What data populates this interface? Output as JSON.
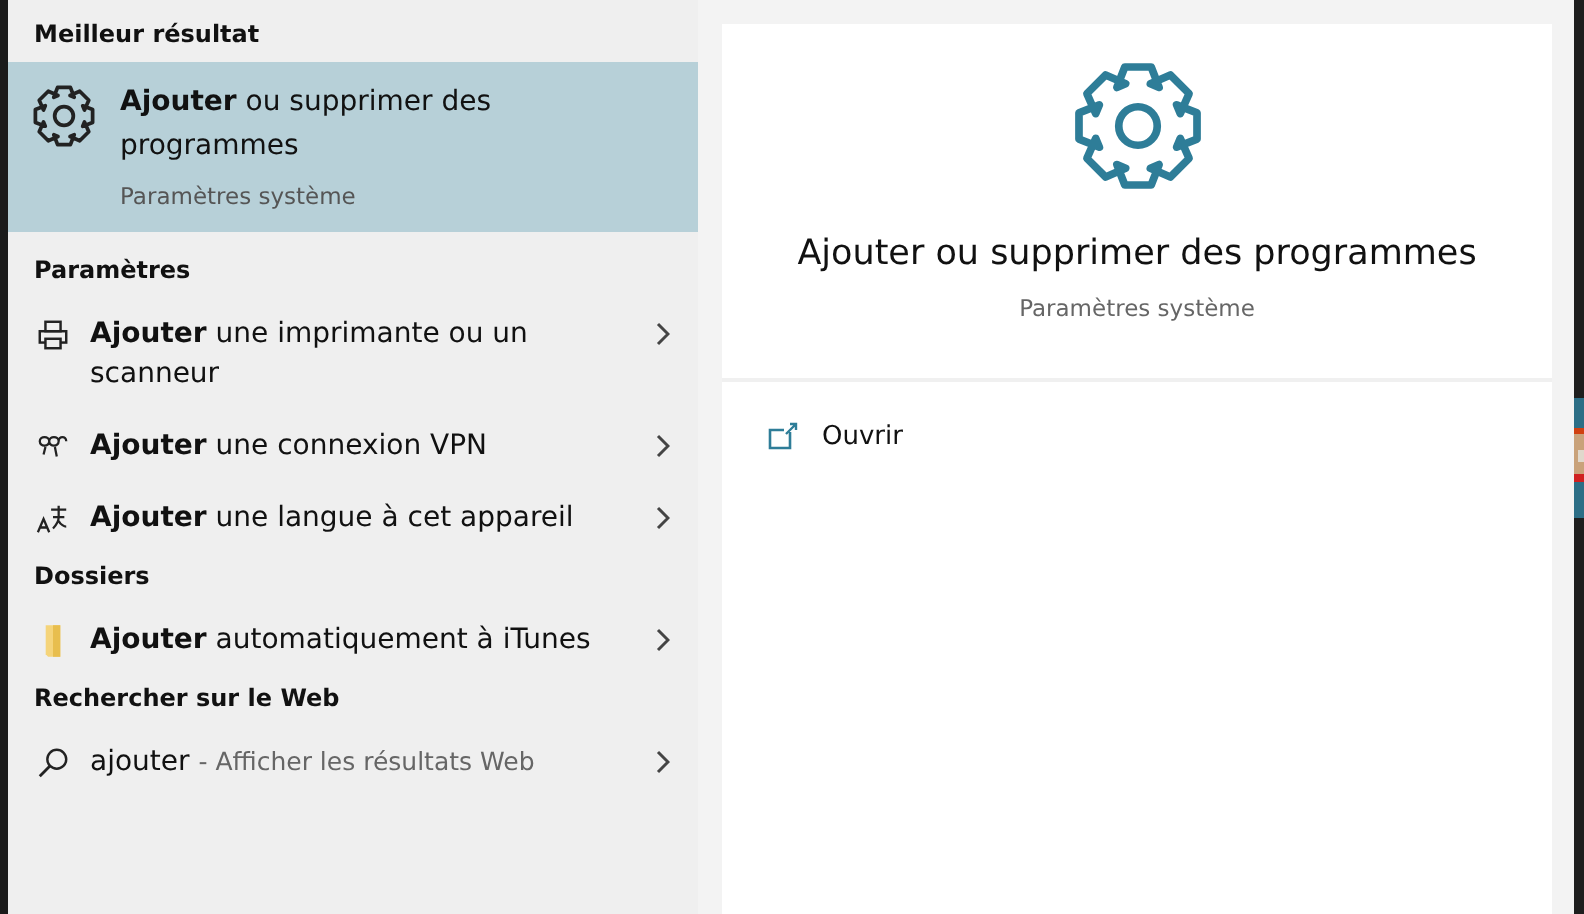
{
  "best_result": {
    "heading": "Meilleur résultat",
    "item": {
      "kind": "gear",
      "title": "**Ajouter** ou supprimer des programmes",
      "subtitle": "Paramètres système",
      "selected": true
    }
  },
  "groups": [
    {
      "heading": "Paramètres",
      "items": [
        {
          "kind": "printer",
          "title": "**Ajouter** une imprimante ou un scanneur",
          "selected": false
        },
        {
          "kind": "vpn",
          "title": "**Ajouter** une connexion VPN",
          "selected": false
        },
        {
          "kind": "language",
          "title": "**Ajouter** une langue à cet appareil",
          "selected": false
        }
      ]
    },
    {
      "heading": "Dossiers",
      "items": [
        {
          "kind": "folder",
          "title": "**Ajouter** automatiquement à iTunes",
          "selected": false
        }
      ]
    },
    {
      "heading": "Rechercher sur le Web",
      "items": [
        {
          "kind": "search",
          "title": "ajouter",
          "hint": "- Afficher les résultats Web",
          "selected": false
        }
      ]
    }
  ],
  "detail": {
    "title": "Ajouter ou supprimer des programmes",
    "subtitle": "Paramètres système",
    "actions": [
      {
        "kind": "open",
        "label": "Ouvrir"
      }
    ]
  }
}
